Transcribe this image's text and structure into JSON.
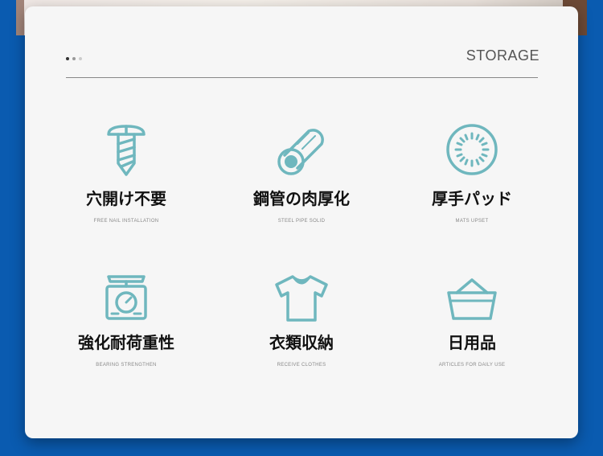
{
  "header": {
    "title": "STORAGE",
    "pager_dots": 3,
    "active_dot": 0
  },
  "colors": {
    "background": "#0a5bb0",
    "card": "#f6f6f6",
    "icon": "#6fb7be"
  },
  "features": [
    {
      "icon": "screw-icon",
      "title": "穴開け不要",
      "subtitle": "FREE NAIL INSTALLATION"
    },
    {
      "icon": "steel-pipe-icon",
      "title": "鋼管の肉厚化",
      "subtitle": "STEEL PIPE SOLID"
    },
    {
      "icon": "pad-icon",
      "title": "厚手パッド",
      "subtitle": "MATS UPSET"
    },
    {
      "icon": "scale-icon",
      "title": "強化耐荷重性",
      "subtitle": "BEARING STRENGTHEN"
    },
    {
      "icon": "tshirt-icon",
      "title": "衣類収納",
      "subtitle": "RECEIVE CLOTHES"
    },
    {
      "icon": "basket-icon",
      "title": "日用品",
      "subtitle": "ARTICLES FOR DAILY USE"
    }
  ]
}
